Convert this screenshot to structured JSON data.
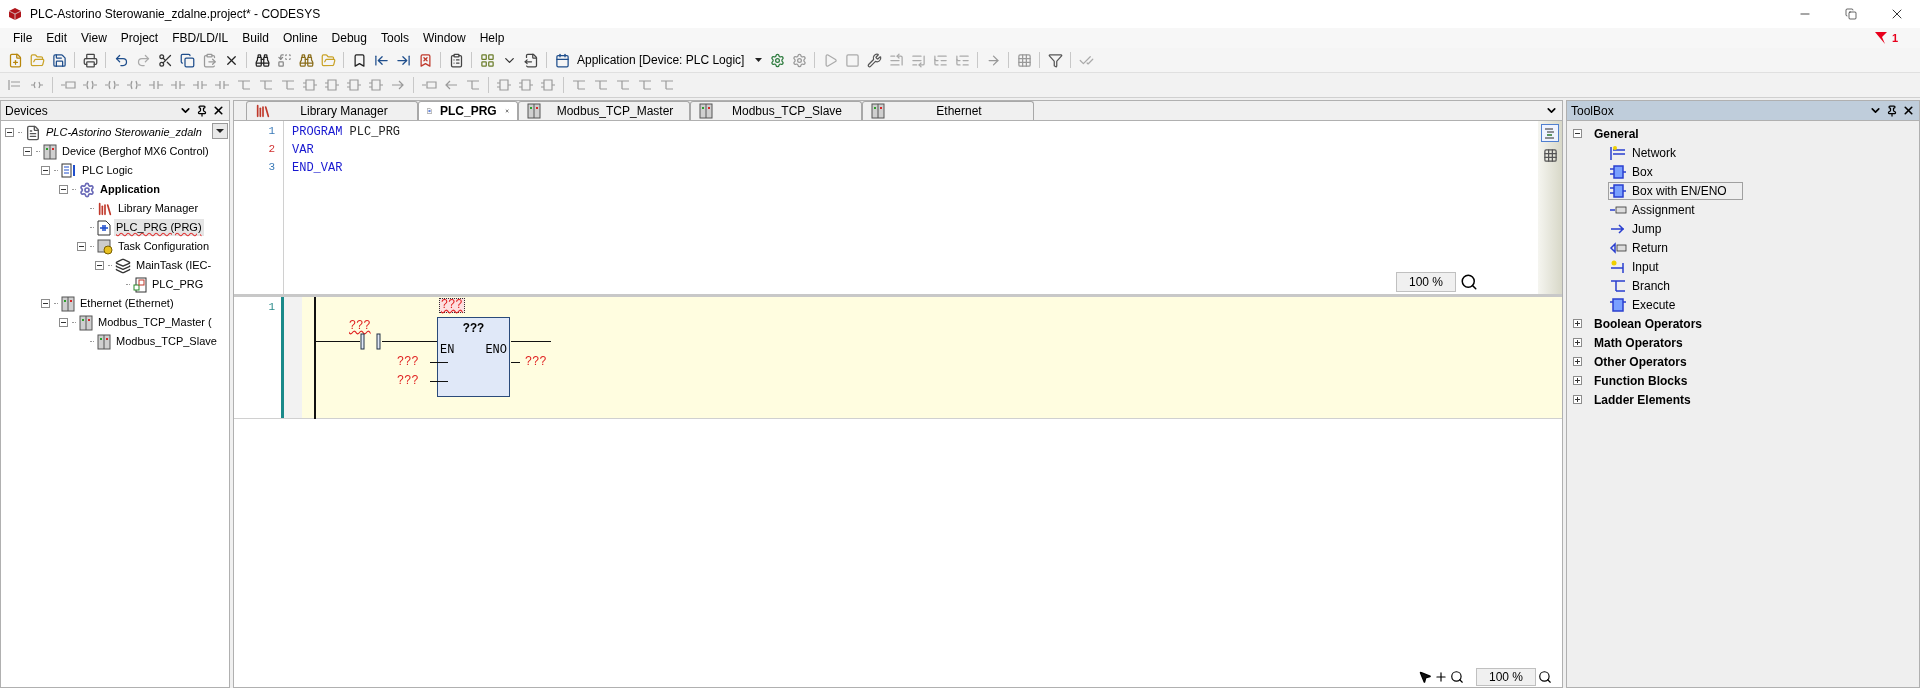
{
  "window": {
    "title": "PLC-Astorino Sterowanie_zdalne.project* - CODESYS"
  },
  "menu": [
    "File",
    "Edit",
    "View",
    "Project",
    "FBD/LD/IL",
    "Build",
    "Online",
    "Debug",
    "Tools",
    "Window",
    "Help"
  ],
  "notifications": {
    "count": "1"
  },
  "toolbar": {
    "application_combo": "Application [Device: PLC Logic]"
  },
  "devices": {
    "title": "Devices",
    "tree": [
      {
        "label": "PLC-Astorino Sterowanie_zdaln",
        "kind": "project",
        "selected": false,
        "expanded": true,
        "children": [
          {
            "label": "Device (Berghof MX6 Control)",
            "kind": "device",
            "selected": false,
            "expanded": true,
            "children": [
              {
                "label": "PLC Logic",
                "kind": "logic",
                "selected": false,
                "expanded": true,
                "children": [
                  {
                    "label": "Application",
                    "kind": "application",
                    "selected": false,
                    "expanded": true,
                    "children": [
                      {
                        "label": "Library Manager",
                        "kind": "library",
                        "selected": false
                      },
                      {
                        "label": "PLC_PRG (PRG)",
                        "kind": "pou",
                        "selected": true
                      },
                      {
                        "label": "Task Configuration",
                        "kind": "tasks",
                        "selected": false,
                        "expanded": true,
                        "children": [
                          {
                            "label": "MainTask (IEC-",
                            "kind": "task",
                            "selected": false,
                            "expanded": true,
                            "children": [
                              {
                                "label": "PLC_PRG",
                                "kind": "call",
                                "selected": false
                              }
                            ]
                          }
                        ]
                      }
                    ]
                  }
                ]
              },
              {
                "label": "Ethernet (Ethernet)",
                "kind": "device",
                "selected": false,
                "expanded": true,
                "children": [
                  {
                    "label": "Modbus_TCP_Master (",
                    "kind": "device",
                    "selected": false,
                    "expanded": true,
                    "children": [
                      {
                        "label": "Modbus_TCP_Slave",
                        "kind": "device",
                        "selected": false
                      }
                    ]
                  }
                ]
              }
            ]
          }
        ]
      }
    ]
  },
  "editor": {
    "tabs": [
      {
        "label": "Library Manager",
        "kind": "library",
        "selected": false
      },
      {
        "label": "PLC_PRG",
        "kind": "pou",
        "selected": true
      },
      {
        "label": "Modbus_TCP_Master",
        "kind": "device",
        "selected": false
      },
      {
        "label": "Modbus_TCP_Slave",
        "kind": "device",
        "selected": false
      },
      {
        "label": "Ethernet",
        "kind": "device",
        "selected": false
      }
    ],
    "code_lines": [
      {
        "number": "1",
        "changed": false,
        "tokens": [
          {
            "text": "PROGRAM",
            "kind": "keyword"
          },
          {
            "text": " PLC_PRG",
            "kind": "plain"
          }
        ]
      },
      {
        "number": "2",
        "changed": true,
        "tokens": [
          {
            "text": "VAR",
            "kind": "keyword"
          }
        ]
      },
      {
        "number": "3",
        "changed": false,
        "tokens": [
          {
            "text": "END_VAR",
            "kind": "keyword"
          }
        ]
      }
    ],
    "declaration_zoom": "100 %",
    "network": {
      "number": "1",
      "contact_variable": "???",
      "box_instance": "???",
      "box_type": "???",
      "enable_in": "EN",
      "enable_out": "ENO",
      "inputs": [
        "???",
        "???"
      ],
      "output": "???"
    },
    "body_zoom": "100 %"
  },
  "toolbox": {
    "title": "ToolBox",
    "groups": [
      {
        "label": "General",
        "expanded": true,
        "items": [
          {
            "label": "Network",
            "kind": "network",
            "selected": false
          },
          {
            "label": "Box",
            "kind": "box",
            "selected": false
          },
          {
            "label": "Box with EN/ENO",
            "kind": "box",
            "selected": true
          },
          {
            "label": "Assignment",
            "kind": "assignment",
            "selected": false
          },
          {
            "label": "Jump",
            "kind": "jump",
            "selected": false
          },
          {
            "label": "Return",
            "kind": "return",
            "selected": false
          },
          {
            "label": "Input",
            "kind": "input",
            "selected": false
          },
          {
            "label": "Branch",
            "kind": "branch",
            "selected": false
          },
          {
            "label": "Execute",
            "kind": "execute",
            "selected": false
          }
        ]
      },
      {
        "label": "Boolean Operators",
        "expanded": false
      },
      {
        "label": "Math Operators",
        "expanded": false
      },
      {
        "label": "Other Operators",
        "expanded": false
      },
      {
        "label": "Function Blocks",
        "expanded": false
      },
      {
        "label": "Ladder Elements",
        "expanded": false
      }
    ]
  }
}
